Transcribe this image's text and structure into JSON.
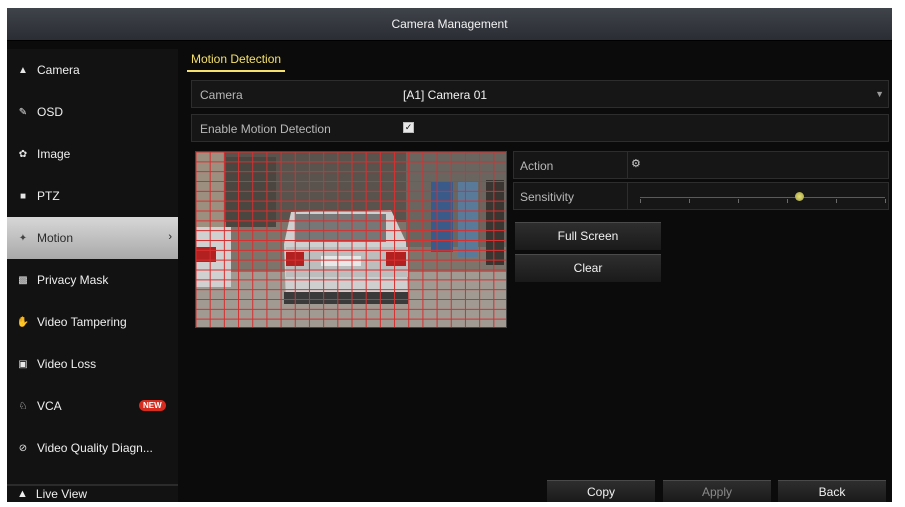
{
  "window": {
    "title": "Camera Management"
  },
  "sidebar": {
    "items": [
      {
        "label": "Camera",
        "icon": "camera-icon"
      },
      {
        "label": "OSD",
        "icon": "osd-icon"
      },
      {
        "label": "Image",
        "icon": "image-icon"
      },
      {
        "label": "PTZ",
        "icon": "ptz-icon"
      },
      {
        "label": "Motion",
        "icon": "motion-icon",
        "active": true
      },
      {
        "label": "Privacy Mask",
        "icon": "privacy-mask-icon"
      },
      {
        "label": "Video Tampering",
        "icon": "video-tampering-icon"
      },
      {
        "label": "Video Loss",
        "icon": "video-loss-icon"
      },
      {
        "label": "VCA",
        "icon": "vca-icon",
        "badge": "NEW"
      },
      {
        "label": "Video Quality Diagn...",
        "icon": "video-quality-icon"
      }
    ],
    "live_view": "Live View"
  },
  "tab": {
    "label": "Motion Detection"
  },
  "form": {
    "camera_label": "Camera",
    "camera_value": "[A1] Camera 01",
    "enable_label": "Enable Motion Detection",
    "enable_checked": true,
    "action_label": "Action",
    "sensitivity_label": "Sensitivity",
    "sensitivity_level": 0.65
  },
  "buttons": {
    "full_screen": "Full Screen",
    "clear": "Clear",
    "copy": "Copy",
    "apply": "Apply",
    "back": "Back"
  },
  "colors": {
    "accent_yellow": "#f4e06a",
    "grid_red": "#d63030",
    "badge_red": "#d62c1f"
  }
}
